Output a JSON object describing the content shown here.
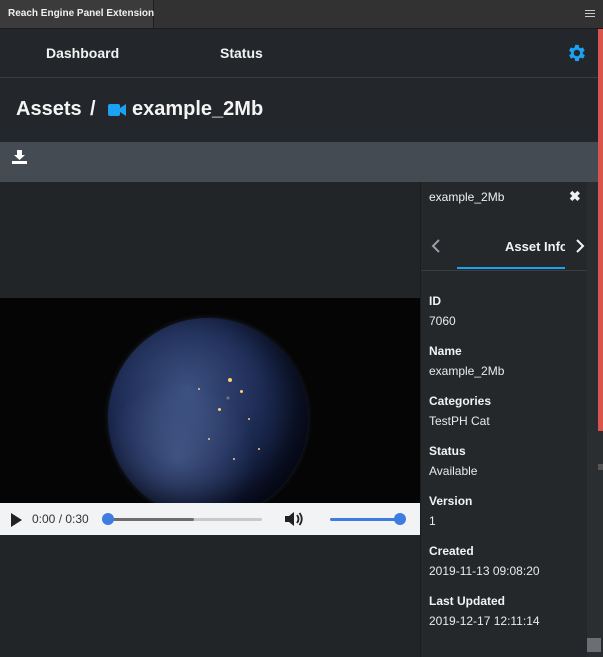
{
  "window": {
    "tab_title": "Reach Engine Panel Extension",
    "menu_icon": "hamburger-menu-icon"
  },
  "nav": {
    "dashboard": "Dashboard",
    "status": "Status",
    "settings_icon": "gear-icon",
    "accent": "#1da1f2"
  },
  "breadcrumb": {
    "root": "Assets",
    "separator": "/",
    "asset_icon": "video-camera-icon",
    "asset_name": "example_2Mb"
  },
  "toolbar": {
    "download_icon": "download-icon"
  },
  "player": {
    "time": "0:00 / 0:30",
    "progress": 0.0,
    "buffered": 0.56,
    "volume": 1.0,
    "play_icon": "play-icon",
    "volume_icon": "volume-icon"
  },
  "panel": {
    "title": "example_2Mb",
    "close_icon": "close-icon",
    "active_tab": "Asset Info",
    "fields": [
      {
        "label": "ID",
        "value": "7060"
      },
      {
        "label": "Name",
        "value": "example_2Mb"
      },
      {
        "label": "Categories",
        "value": "TestPH Cat"
      },
      {
        "label": "Status",
        "value": "Available"
      },
      {
        "label": "Version",
        "value": "1"
      },
      {
        "label": "Created",
        "value": "2019-11-13 09:08:20"
      },
      {
        "label": "Last Updated",
        "value": "2019-12-17 12:11:14"
      }
    ]
  }
}
